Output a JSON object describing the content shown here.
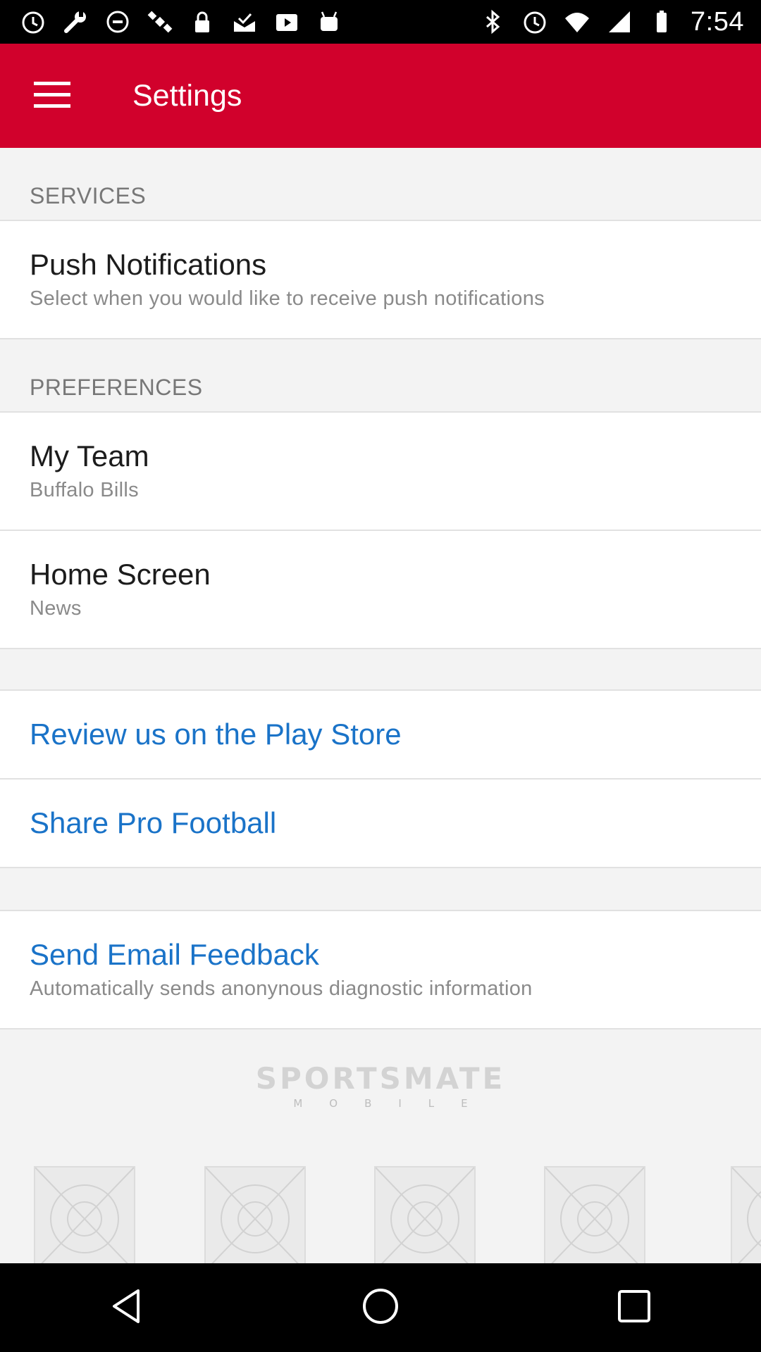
{
  "status_bar": {
    "time": "7:54",
    "left_icons": [
      "alarm-icon",
      "wrench-icon",
      "no-entry-icon",
      "satellite-icon",
      "lock-icon",
      "mail-check-icon",
      "play-box-icon",
      "android-icon"
    ],
    "right_icons": [
      "bluetooth-icon",
      "alarm-icon",
      "wifi-icon",
      "signal-icon",
      "battery-icon"
    ]
  },
  "app_bar": {
    "title": "Settings",
    "menu_icon": "hamburger-menu-icon",
    "background": "#d1012c"
  },
  "sections": {
    "services": {
      "header": "SERVICES",
      "push": {
        "title": "Push Notifications",
        "subtitle": "Select when you would like to receive push notifications"
      }
    },
    "preferences": {
      "header": "PREFERENCES",
      "my_team": {
        "title": "My Team",
        "value": "Buffalo Bills"
      },
      "home_screen": {
        "title": "Home Screen",
        "value": "News"
      }
    },
    "links": {
      "review": "Review us on the Play Store",
      "share": "Share Pro Football",
      "link_color": "#1a73c8"
    },
    "feedback": {
      "title": "Send Email Feedback",
      "subtitle": "Automatically sends anonynous diagnostic information"
    }
  },
  "brand": {
    "name": "SPORTSMATE",
    "sub": "MOBILE"
  },
  "nav_bar": {
    "back_icon": "back-triangle-icon",
    "home_icon": "home-circle-icon",
    "recents_icon": "recents-square-icon"
  }
}
